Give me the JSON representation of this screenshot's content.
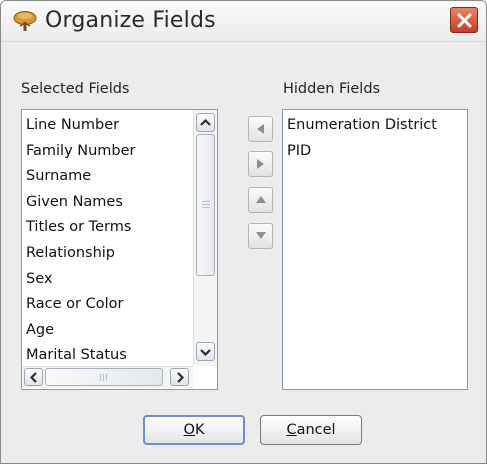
{
  "window": {
    "title": "Organize Fields"
  },
  "selected": {
    "label": "Selected Fields",
    "items": [
      "Line Number",
      "Family Number",
      "Surname",
      "Given Names",
      "Titles or Terms",
      "Relationship",
      "Sex",
      "Race or Color",
      "Age",
      "Marital Status"
    ]
  },
  "hidden": {
    "label": "Hidden Fields",
    "items": [
      "Enumeration District",
      "PID"
    ]
  },
  "buttons": {
    "ok_mnemonic": "O",
    "ok_rest": "K",
    "cancel_mnemonic": "C",
    "cancel_rest": "ancel"
  },
  "icons": [
    "tree-app-icon",
    "close-icon",
    "arrow-left-icon",
    "arrow-right-icon",
    "arrow-up-icon",
    "arrow-down-icon"
  ],
  "colors": {
    "close_button": "#c63d25",
    "list_border": "#7f9db9",
    "default_button_border": "#6d8fd0"
  }
}
